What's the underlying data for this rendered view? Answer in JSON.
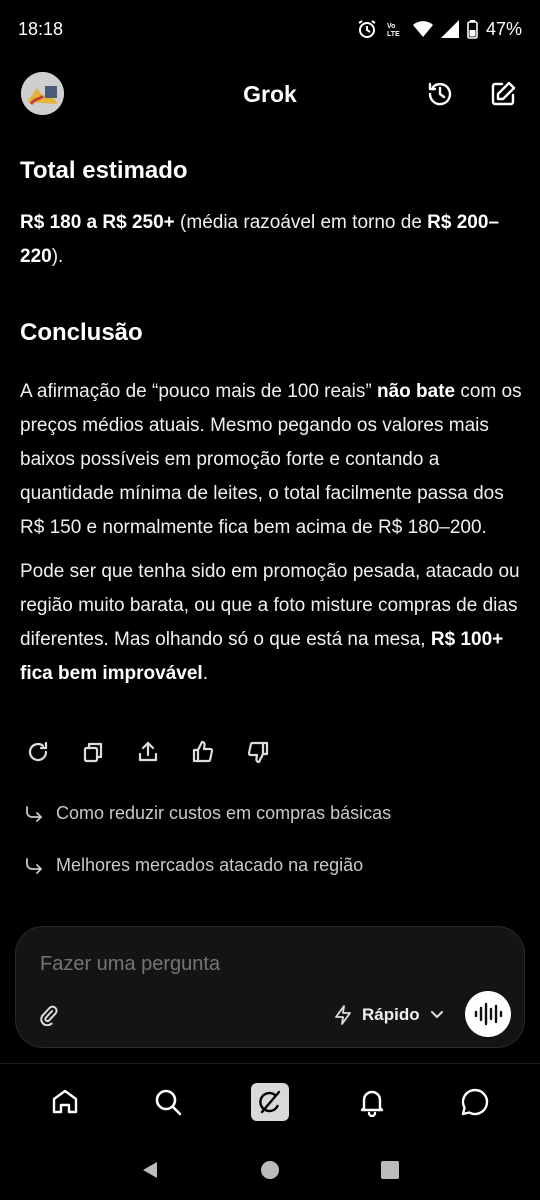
{
  "status_bar": {
    "time": "18:18",
    "battery": "47%",
    "icons": [
      "alarm-icon",
      "volte-icon",
      "wifi-icon",
      "signal-icon",
      "battery-icon"
    ]
  },
  "header": {
    "title": "Grok",
    "icons": [
      "avatar",
      "history-icon",
      "new-chat-icon"
    ]
  },
  "content": {
    "total_heading": "Total estimado",
    "total_bold_1": "R$ 180 a R$ 250+",
    "total_text_1": " (média razoável em torno de ",
    "total_bold_2": "R$ 200–220",
    "total_text_2": ").",
    "conclusion_heading": "Conclusão",
    "para1_a": "A afirmação de “pouco mais de 100 reais” ",
    "para1_bold": "não bate",
    "para1_b": " com os preços médios atuais. Mesmo pegando os valores mais baixos possíveis em promoção forte e contando a quantidade mínima de leites, o total facilmente passa dos R$ 150 e normalmente fica bem acima de R$ 180–200.",
    "para2_a": "Pode ser que tenha sido em promoção pesada, atacado ou região muito barata, ou que a foto misture compras de dias diferentes. Mas olhando só o que está na mesa, ",
    "para2_bold": "R$ 100+ fica bem improvável",
    "para2_b": "."
  },
  "actions": [
    "regenerate-icon",
    "copy-icon",
    "share-icon",
    "thumbs-up-icon",
    "thumbs-down-icon"
  ],
  "suggestions": [
    "Como reduzir custos em compras básicas",
    "Melhores mercados atacado na região"
  ],
  "composer": {
    "placeholder": "Fazer uma pergunta",
    "mode": "Rápido"
  },
  "bottom_nav": [
    "home-icon",
    "search-icon",
    "grok-logo-icon",
    "notifications-icon",
    "messages-icon"
  ],
  "colors": {
    "background": "#000000",
    "text": "#ffffff",
    "muted": "#8a8a8a",
    "composer_bg": "#141414"
  }
}
